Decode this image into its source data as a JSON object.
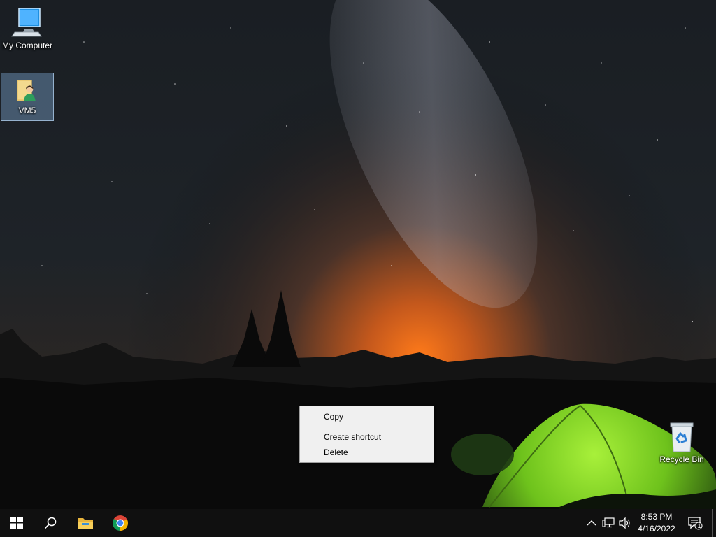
{
  "desktop": {
    "icons": [
      {
        "label": "My Computer",
        "icon": "computer-icon"
      },
      {
        "label": "VM5",
        "icon": "user-folder-icon",
        "selected": true
      },
      {
        "label": "Recycle Bin",
        "icon": "recycle-bin-icon"
      }
    ]
  },
  "context_menu": {
    "items": [
      "Copy",
      "Create shortcut",
      "Delete"
    ]
  },
  "taskbar": {
    "pinned": [
      "start-icon",
      "search-icon",
      "file-explorer-icon",
      "chrome-icon"
    ],
    "tray": {
      "icons": [
        "chevron-up-icon",
        "network-icon",
        "volume-icon"
      ],
      "time": "8:53 PM",
      "date": "4/16/2022",
      "notification_count": "1"
    }
  },
  "colors": {
    "taskbar": "#101010",
    "menu_bg": "#f0f0f0",
    "tent": "#7ed321"
  }
}
